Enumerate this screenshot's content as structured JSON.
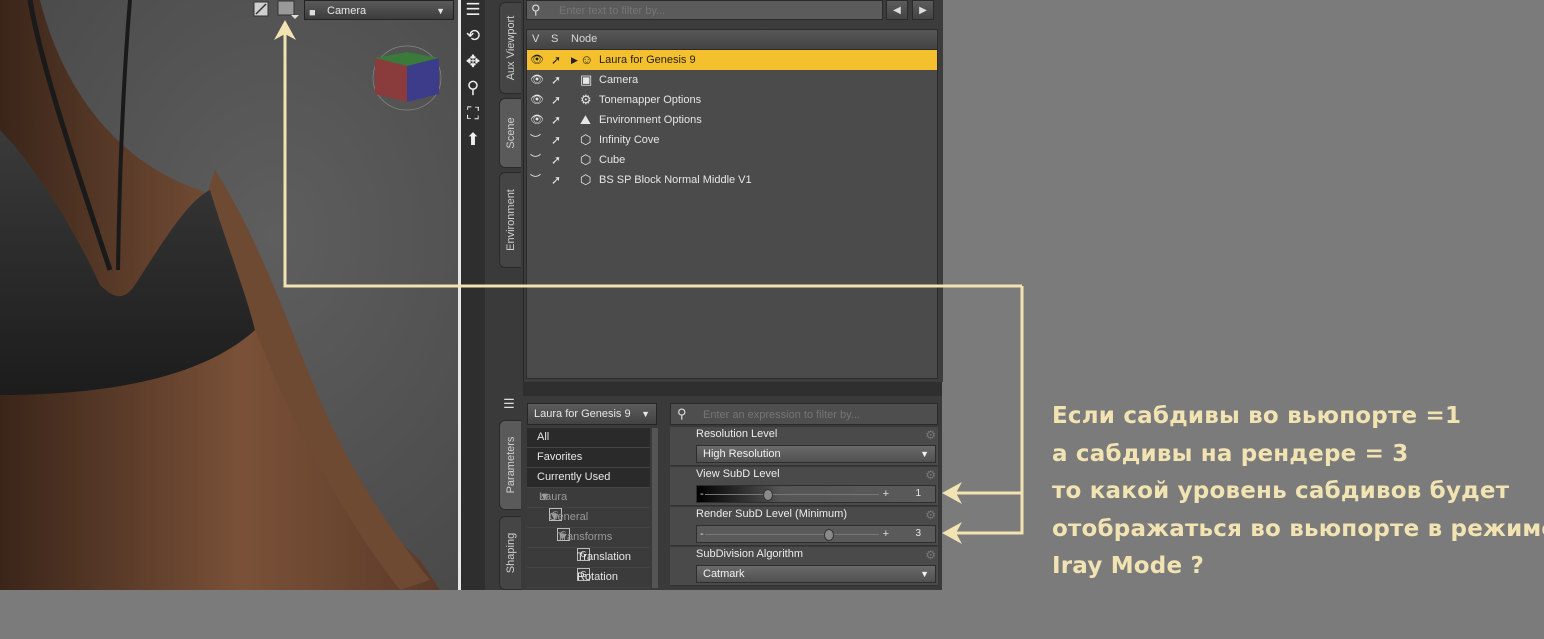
{
  "viewport": {
    "camera_select": "Camera"
  },
  "tool_strip": {
    "icons": [
      "menu-icon",
      "orbit-icon",
      "pan-icon",
      "zoom-icon",
      "frame-icon",
      "reset-icon"
    ]
  },
  "side_tabs": {
    "top": [
      "Aux Viewport",
      "Scene",
      "Environment"
    ],
    "bottom": [
      "Parameters",
      "Shaping"
    ]
  },
  "scene": {
    "filter_placeholder": "Enter text to filter by...",
    "columns": {
      "v": "V",
      "s": "S",
      "node": "Node"
    },
    "nodes": [
      {
        "name": "Laura for Genesis 9",
        "selected": true,
        "icon": "figure-icon"
      },
      {
        "name": "Camera",
        "selected": false,
        "icon": "camera-icon"
      },
      {
        "name": "Tonemapper Options",
        "selected": false,
        "icon": "tonemapper-icon"
      },
      {
        "name": "Environment Options",
        "selected": false,
        "icon": "environment-icon"
      },
      {
        "name": "Infinity Cove",
        "selected": false,
        "icon": "prop-icon"
      },
      {
        "name": "Cube",
        "selected": false,
        "icon": "prop-icon"
      },
      {
        "name": "BS SP Block Normal Middle V1",
        "selected": false,
        "icon": "prop-icon"
      }
    ]
  },
  "parameters": {
    "node_select": "Laura for Genesis 9",
    "filter_placeholder": "Enter an expression to filter by...",
    "groups": {
      "all": "All",
      "favorites": "Favorites",
      "currently_used": "Currently Used",
      "node": "Laura for Genes...",
      "general": "General",
      "transforms": "Transforms",
      "translation": "Translation",
      "rotation": "Rotation"
    },
    "properties": {
      "resolution_level": {
        "label": "Resolution Level",
        "value": "High Resolution"
      },
      "view_subd": {
        "label": "View SubD Level",
        "value": "1",
        "min_label": "-",
        "max_label": "+",
        "fraction": 0.35
      },
      "render_subd": {
        "label": "Render SubD Level (Minimum)",
        "value": "3",
        "min_label": "-",
        "max_label": "+",
        "fraction": 0.7
      },
      "subd_algorithm": {
        "label": "SubDivision Algorithm",
        "value": "Catmark"
      }
    }
  },
  "annotation": {
    "lines": [
      "Если сабдивы во вьюпорте =1",
      "а сабдивы на рендере = 3",
      "то какой уровень сабдивов будет",
      "отображаться во вьюпорте в режиме",
      "Iray Mode ?"
    ],
    "color": "#f1e3b2"
  },
  "colors": {
    "selection": "#f4c02e",
    "arrow": "#f1e3b2"
  }
}
